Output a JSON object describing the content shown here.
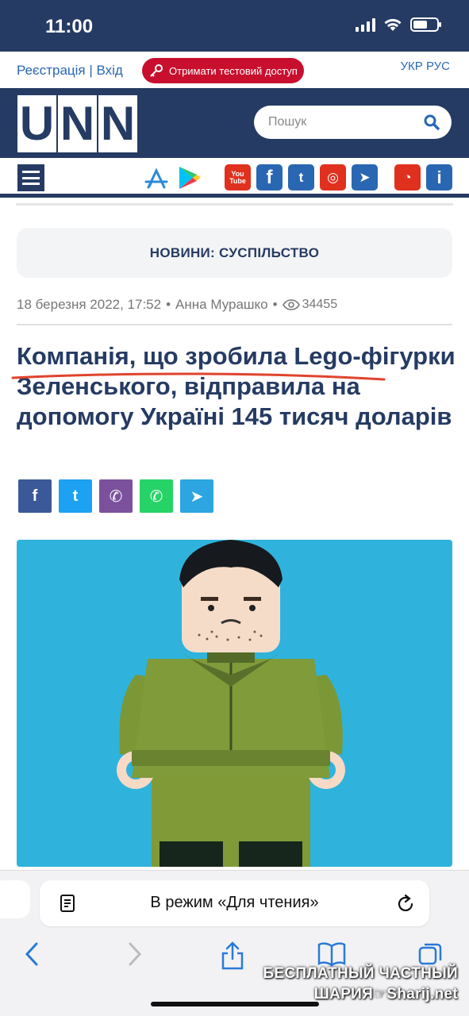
{
  "status_bar": {
    "time": "11:00"
  },
  "top_bar": {
    "auth": "Реєстрація | Вхід",
    "trial_button": "Отримати тестовий доступ",
    "languages": "УКР РУС"
  },
  "header": {
    "logo_letters": [
      "U",
      "N",
      "N"
    ],
    "search_placeholder": "Пошук"
  },
  "nav": {
    "social": [
      {
        "name": "youtube",
        "label": "You Tube",
        "color": "#e0301e"
      },
      {
        "name": "facebook",
        "label": "f",
        "color": "#2a67b3"
      },
      {
        "name": "twitter",
        "label": "t",
        "color": "#2a67b3"
      },
      {
        "name": "instagram",
        "label": "◎",
        "color": "#e0301e"
      },
      {
        "name": "telegram",
        "label": "➤",
        "color": "#2a67b3"
      },
      {
        "name": "rss",
        "label": "◔",
        "color": "#e0301e"
      },
      {
        "name": "info",
        "label": "i",
        "color": "#2a67b3"
      }
    ]
  },
  "article": {
    "rubric": "НОВИНИ: СУСПІЛЬСТВО",
    "date": "18 березня 2022, 17:52",
    "bullet": "•",
    "author": "Анна Мурашко",
    "views": "34455",
    "headline": "Компанія, що зробила Lego-фігурки Зеленського, відправила на допомогу Україні 145 тисяч доларів",
    "share_buttons": [
      {
        "name": "facebook",
        "label": "f",
        "color": "#3b5998"
      },
      {
        "name": "twitter",
        "label": "t",
        "color": "#1da1f2"
      },
      {
        "name": "viber",
        "label": "✆",
        "color": "#7b519d"
      },
      {
        "name": "whatsapp",
        "label": "✆",
        "color": "#25d366"
      },
      {
        "name": "telegram",
        "label": "➤",
        "color": "#2ca5e0"
      }
    ]
  },
  "safari": {
    "reader_label": "В режим «Для чтения»"
  },
  "watermark": {
    "line1": "БЕСПЛАТНЫЙ ЧАСТНЫЙ",
    "line2": "ШАРИЯ☞Sharij.net"
  }
}
